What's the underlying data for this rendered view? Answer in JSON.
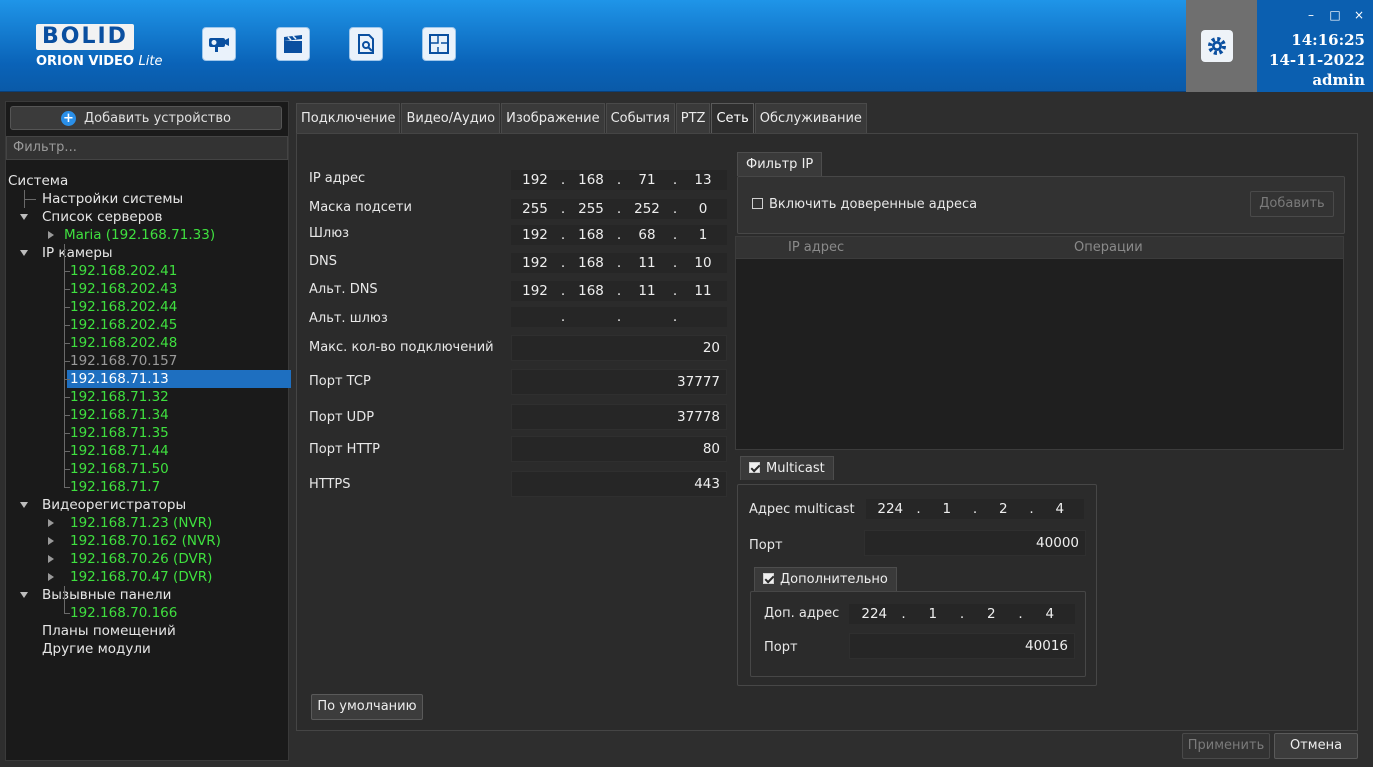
{
  "app": {
    "logo_text": "BOLID",
    "logo_sub_bold": "ORION VIDEO",
    "logo_sub_italic": "Lite",
    "time": "14:16:25",
    "date": "14-11-2022",
    "user": "admin",
    "toolbar_icons": [
      "camera-icon",
      "clapperboard-icon",
      "document-search-icon",
      "floor-plan-icon"
    ]
  },
  "sidebar": {
    "add_device": "Добавить устройство",
    "filter_placeholder": "Фильтр...",
    "system": "Система",
    "settings": "Настройки системы",
    "servers": "Список серверов",
    "server_item": "Maria (192.168.71.33)",
    "ip_cameras": "IP камеры",
    "cameras": [
      "192.168.202.41",
      "192.168.202.43",
      "192.168.202.44",
      "192.168.202.45",
      "192.168.202.48",
      "192.168.70.157",
      "192.168.71.13",
      "192.168.71.32",
      "192.168.71.34",
      "192.168.71.35",
      "192.168.71.44",
      "192.168.71.50",
      "192.168.71.7"
    ],
    "recorders": "Видеорегистраторы",
    "recorder_items": [
      "192.168.71.23 (NVR)",
      "192.168.70.162 (NVR)",
      "192.168.70.26 (DVR)",
      "192.168.70.47 (DVR)"
    ],
    "call_panels": "Вызывные панели",
    "call_panel_items": [
      "192.168.70.166"
    ],
    "floor_plans": "Планы помещений",
    "other_modules": "Другие модули"
  },
  "tabs": [
    "Подключение",
    "Видео/Аудио",
    "Изображение",
    "События",
    "PTZ",
    "Сеть",
    "Обслуживание"
  ],
  "network": {
    "ip_label": "IP адрес",
    "ip": [
      "192",
      "168",
      "71",
      "13"
    ],
    "mask_label": "Маска подсети",
    "mask": [
      "255",
      "255",
      "252",
      "0"
    ],
    "gw_label": "Шлюз",
    "gw": [
      "192",
      "168",
      "68",
      "1"
    ],
    "dns_label": "DNS",
    "dns": [
      "192",
      "168",
      "11",
      "10"
    ],
    "alt_dns_label": "Альт. DNS",
    "alt_dns": [
      "192",
      "168",
      "11",
      "11"
    ],
    "alt_gw_label": "Альт. шлюз",
    "alt_gw": [
      "",
      "",
      "",
      ""
    ],
    "max_conn_label": "Макс. кол-во подключений",
    "max_conn": "20",
    "tcp_label": "Порт TCP",
    "tcp": "37777",
    "udp_label": "Порт UDP",
    "udp": "37778",
    "http_label": "Порт HTTP",
    "http": "80",
    "https_label": "HTTPS",
    "https": "443",
    "default_btn": "По умолчанию"
  },
  "ipfilter": {
    "tab": "Фильтр IP",
    "enable_label": "Включить доверенные адреса",
    "add_btn": "Добавить",
    "col_ip": "IP адрес",
    "col_ops": "Операции"
  },
  "multicast": {
    "tab": "Multicast",
    "addr_label": "Адрес multicast",
    "addr": [
      "224",
      "1",
      "2",
      "4"
    ],
    "port_label": "Порт",
    "port": "40000",
    "extra_tab": "Дополнительно",
    "extra_addr_label": "Доп. адрес",
    "extra_addr": [
      "224",
      "1",
      "2",
      "4"
    ],
    "extra_port_label": "Порт",
    "extra_port": "40016"
  },
  "footer": {
    "apply": "Применить",
    "cancel": "Отмена"
  }
}
